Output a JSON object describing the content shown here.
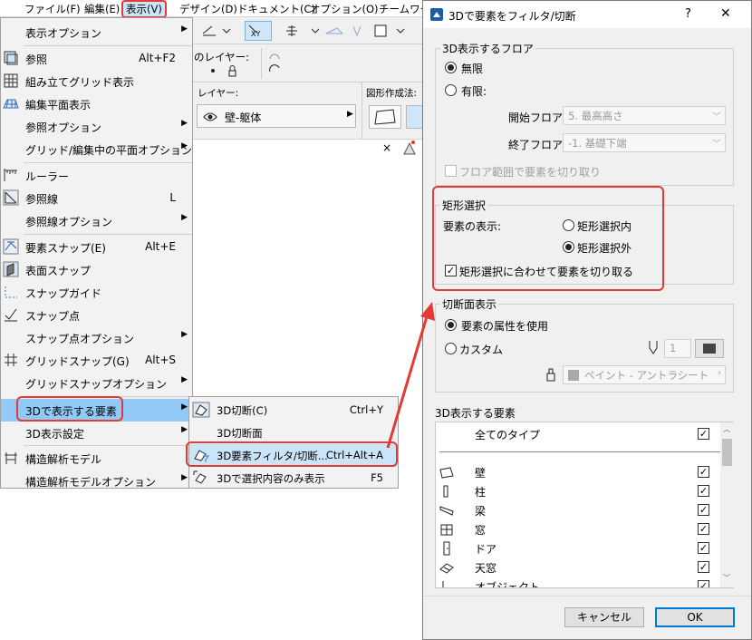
{
  "menubar": [
    "ファイル(F)",
    "編集(E)",
    "表示(V)",
    "デザイン(D)",
    "ドキュメント(C)",
    "オプション(O)",
    "チームワー"
  ],
  "toolbar": {
    "layer_label": "のレイヤー:",
    "layer_label2": "レイヤー:",
    "layer_value": "壁-躯体",
    "shape_label": "図形作成法:",
    "close_x": "×"
  },
  "view_menu": [
    {
      "label": "表示オプション",
      "shortcut": "",
      "arrow": true,
      "icon": ""
    },
    {
      "label": "参照",
      "shortcut": "Alt+F2",
      "arrow": false,
      "icon": "reference-icon"
    },
    {
      "label": "組み立てグリッド表示",
      "shortcut": "",
      "arrow": false,
      "icon": "grid-icon"
    },
    {
      "label": "編集平面表示",
      "shortcut": "",
      "arrow": false,
      "icon": "edit-plane-icon"
    },
    {
      "label": "参照オプション",
      "shortcut": "",
      "arrow": true,
      "icon": ""
    },
    {
      "label": "グリッド/編集中の平面オプション",
      "shortcut": "",
      "arrow": true,
      "icon": ""
    },
    {
      "label": "ルーラー",
      "shortcut": "",
      "arrow": false,
      "icon": "ruler-icon"
    },
    {
      "label": "参照線",
      "shortcut": "L",
      "arrow": false,
      "icon": "guide-line-icon"
    },
    {
      "label": "参照線オプション",
      "shortcut": "",
      "arrow": true,
      "icon": ""
    },
    {
      "label": "要素スナップ(E)",
      "shortcut": "Alt+E",
      "arrow": false,
      "icon": "element-snap-icon"
    },
    {
      "label": "表面スナップ",
      "shortcut": "",
      "arrow": false,
      "icon": "surface-snap-icon"
    },
    {
      "label": "スナップガイド",
      "shortcut": "",
      "arrow": false,
      "icon": "snap-guide-icon"
    },
    {
      "label": "スナップ点",
      "shortcut": "",
      "arrow": false,
      "icon": "snap-point-icon"
    },
    {
      "label": "スナップ点オプション",
      "shortcut": "",
      "arrow": true,
      "icon": ""
    },
    {
      "label": "グリッドスナップ(G)",
      "shortcut": "Alt+S",
      "arrow": false,
      "icon": "grid-snap-icon"
    },
    {
      "label": "グリッドスナップオプション",
      "shortcut": "",
      "arrow": true,
      "icon": ""
    },
    {
      "label": "3Dで表示する要素",
      "shortcut": "",
      "arrow": true,
      "icon": ""
    },
    {
      "label": "3D表示設定",
      "shortcut": "",
      "arrow": true,
      "icon": ""
    },
    {
      "label": "構造解析モデル",
      "shortcut": "",
      "arrow": false,
      "icon": "structural-model-icon"
    },
    {
      "label": "構造解析モデルオプション",
      "shortcut": "",
      "arrow": true,
      "icon": ""
    }
  ],
  "submenu": [
    {
      "label": "3D切断(C)",
      "shortcut": "Ctrl+Y"
    },
    {
      "label": "3D切断面",
      "shortcut": ""
    },
    {
      "label": "3D要素フィルタ/切断...",
      "shortcut": "Ctrl+Alt+A"
    },
    {
      "label": "3Dで選択内容のみ表示",
      "shortcut": "F5"
    }
  ],
  "dialog": {
    "title": "3Dで要素をフィルタ/切断",
    "help": "?",
    "close": "✕",
    "floors": {
      "group": "3D表示するフロア",
      "unlimited": "無限",
      "limited": "有限:",
      "start_label": "開始フロア",
      "start_value": "5. 最高高さ",
      "end_label": "終了フロア",
      "end_value": "-1. 基礎下端",
      "trim_label": "フロア範囲で要素を切り取り"
    },
    "marquee": {
      "group": "矩形選択",
      "show_label": "要素の表示:",
      "inside": "矩形選択内",
      "outside": "矩形選択外",
      "trim_label": "矩形選択に合わせて要素を切り取る"
    },
    "section": {
      "group": "切断面表示",
      "use_attr": "要素の属性を使用",
      "custom": "カスタム",
      "pen_value": "1",
      "fill_value": "ペイント - アントラシート"
    },
    "elements": {
      "group": "3D表示する要素",
      "all": "全てのタイプ",
      "items": [
        "壁",
        "柱",
        "梁",
        "窓",
        "ドア",
        "天窓",
        "オブジェクト"
      ]
    },
    "cancel": "キャンセル",
    "ok": "OK"
  }
}
